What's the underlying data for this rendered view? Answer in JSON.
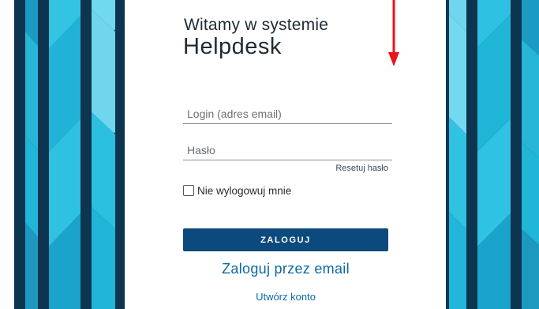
{
  "header": {
    "welcome": "Witamy w systemie",
    "app_name": "Helpdesk"
  },
  "form": {
    "login_placeholder": "Login (adres email)",
    "password_placeholder": "Hasło",
    "reset_password_label": "Resetuj hasło",
    "remember_label": "Nie wylogowuj mnie",
    "remember_checked": false,
    "submit_label": "ZALOGUJ"
  },
  "links": {
    "email_login": "Zaloguj przez email",
    "create_account": "Utwórz konto"
  },
  "colors": {
    "primary_button": "#0c4a7e",
    "link": "#0a6aa3",
    "pattern_dark": "#0d3550",
    "pattern_light": "#6fd6ee",
    "pattern_mid": "#1fb6d8",
    "annotation_arrow": "#e8151b"
  },
  "icons": {
    "checkbox": "checkbox-unchecked-icon",
    "annotation": "red-arrow-down-icon"
  }
}
